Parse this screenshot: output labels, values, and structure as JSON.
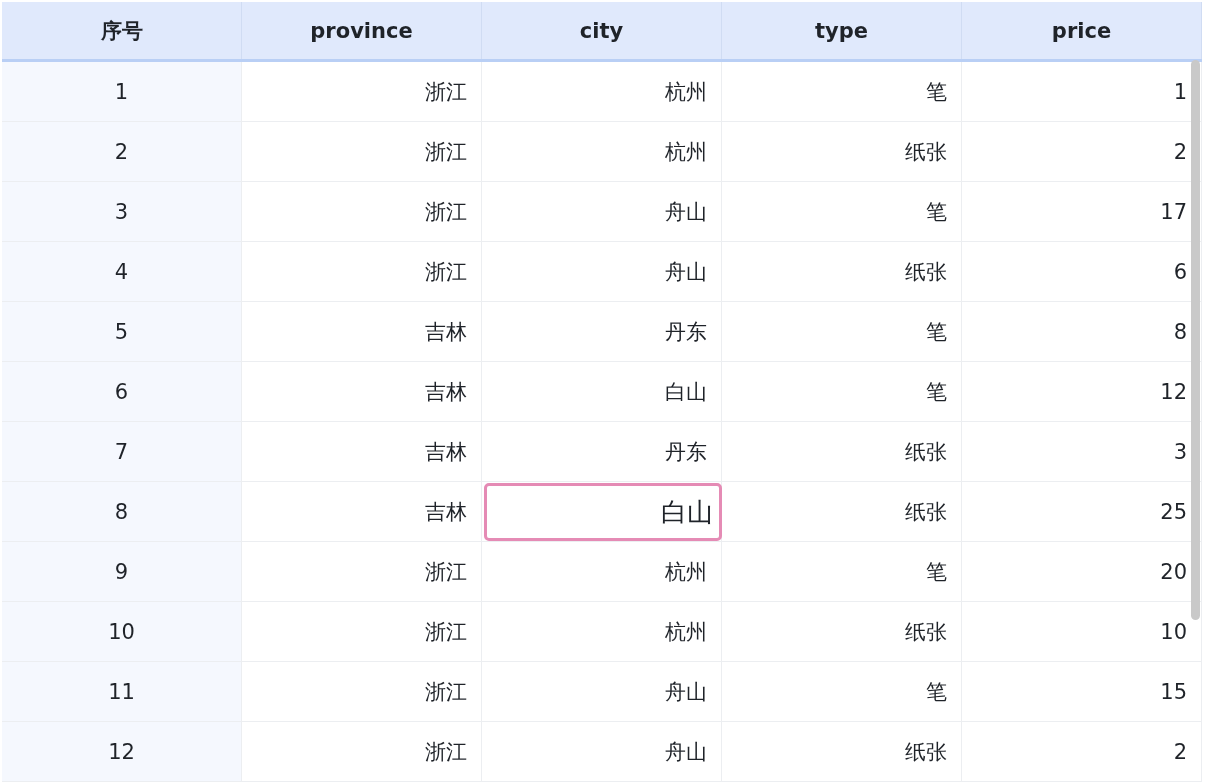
{
  "table": {
    "columns": [
      "序号",
      "province",
      "city",
      "type",
      "price"
    ],
    "rows": [
      {
        "number": "1",
        "cells": [
          {
            "text": "浙江",
            "editing": false
          },
          {
            "text": "杭州",
            "editing": false
          },
          {
            "text": "笔",
            "editing": false
          },
          {
            "text": "1",
            "editing": false
          }
        ]
      },
      {
        "number": "2",
        "cells": [
          {
            "text": "浙江",
            "editing": false
          },
          {
            "text": "杭州",
            "editing": false
          },
          {
            "text": "纸张",
            "editing": false
          },
          {
            "text": "2",
            "editing": false
          }
        ]
      },
      {
        "number": "3",
        "cells": [
          {
            "text": "浙江",
            "editing": false
          },
          {
            "text": "舟山",
            "editing": false
          },
          {
            "text": "笔",
            "editing": false
          },
          {
            "text": "17",
            "editing": false
          }
        ]
      },
      {
        "number": "4",
        "cells": [
          {
            "text": "浙江",
            "editing": false
          },
          {
            "text": "舟山",
            "editing": false
          },
          {
            "text": "纸张",
            "editing": false
          },
          {
            "text": "6",
            "editing": false
          }
        ]
      },
      {
        "number": "5",
        "cells": [
          {
            "text": "吉林",
            "editing": false
          },
          {
            "text": "丹东",
            "editing": false
          },
          {
            "text": "笔",
            "editing": false
          },
          {
            "text": "8",
            "editing": false
          }
        ]
      },
      {
        "number": "6",
        "cells": [
          {
            "text": "吉林",
            "editing": false
          },
          {
            "text": "白山",
            "editing": false
          },
          {
            "text": "笔",
            "editing": false
          },
          {
            "text": "12",
            "editing": false
          }
        ]
      },
      {
        "number": "7",
        "cells": [
          {
            "text": "吉林",
            "editing": false
          },
          {
            "text": "丹东",
            "editing": false
          },
          {
            "text": "纸张",
            "editing": false
          },
          {
            "text": "3",
            "editing": false
          }
        ]
      },
      {
        "number": "8",
        "cells": [
          {
            "text": "吉林",
            "editing": false
          },
          {
            "text": "白山",
            "editing": true
          },
          {
            "text": "纸张",
            "editing": false
          },
          {
            "text": "25",
            "editing": false
          }
        ]
      },
      {
        "number": "9",
        "cells": [
          {
            "text": "浙江",
            "editing": false
          },
          {
            "text": "杭州",
            "editing": false
          },
          {
            "text": "笔",
            "editing": false
          },
          {
            "text": "20",
            "editing": false
          }
        ]
      },
      {
        "number": "10",
        "cells": [
          {
            "text": "浙江",
            "editing": false
          },
          {
            "text": "杭州",
            "editing": false
          },
          {
            "text": "纸张",
            "editing": false
          },
          {
            "text": "10",
            "editing": false
          }
        ]
      },
      {
        "number": "11",
        "cells": [
          {
            "text": "浙江",
            "editing": false
          },
          {
            "text": "舟山",
            "editing": false
          },
          {
            "text": "笔",
            "editing": false
          },
          {
            "text": "15",
            "editing": false
          }
        ]
      },
      {
        "number": "12",
        "cells": [
          {
            "text": "浙江",
            "editing": false
          },
          {
            "text": "舟山",
            "editing": false
          },
          {
            "text": "纸张",
            "editing": false
          },
          {
            "text": "2",
            "editing": false
          }
        ]
      }
    ]
  }
}
